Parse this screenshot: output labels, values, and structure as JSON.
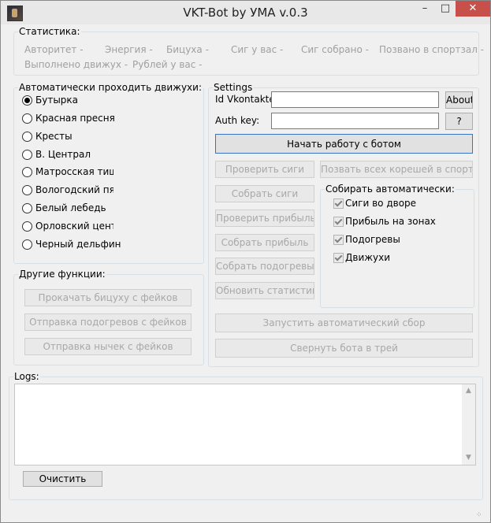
{
  "window": {
    "title": "VKT-Bot by УМА v.0.3",
    "min_glyph": "–",
    "max_glyph": "□",
    "close_glyph": "✕"
  },
  "stats": {
    "legend": "Статистика:",
    "row1": [
      "Авторитет -",
      "Энергия -",
      "Бицуха -",
      "Сиг у вас -",
      "Сиг собрано  -",
      "Позвано в спортзал -"
    ],
    "row2": [
      "Выполнено движух -",
      "Рублей у вас -"
    ]
  },
  "auto": {
    "legend": "Автоматически проходить движухи:",
    "options": [
      "Бутырка",
      "Красная пресня",
      "Кресты",
      "В. Централ",
      "Матросская тишина",
      "Вологодский пятак",
      "Белый лебедь",
      "Орловский централ",
      "Черный дельфин"
    ],
    "selected": "Бутырка"
  },
  "other": {
    "legend": "Другие функции:",
    "buttons": [
      "Прокачать бицуху с фейков",
      "Отправка подогревов с фейков",
      "Отправка нычек с фейков"
    ]
  },
  "settings": {
    "legend": "Settings",
    "id_label": "Id Vkontakte:",
    "id_value": "",
    "auth_label": "Auth key:",
    "auth_value": "",
    "about_label": "About",
    "help_label": "?",
    "start_label": "Начать работу с ботом",
    "left_buttons": [
      "Проверить сиги",
      "Собрать сиги",
      "Проверить прибыль",
      "Собрать прибыль",
      "Собрать подогревы",
      "Обновить статистику"
    ],
    "invite_label": "Позвать всех корешей в спортзал",
    "collect": {
      "legend": "Собирать автоматически:",
      "items": [
        "Сиги во дворе",
        "Прибыль на зонах",
        "Подогревы",
        "Движухи"
      ]
    },
    "run_label": "Запустить автоматический сбор",
    "tray_label": "Свернуть бота в трей"
  },
  "logs": {
    "legend": "Logs:",
    "text": "",
    "clear_label": "Очистить",
    "up_glyph": "▲",
    "down_glyph": "▼",
    "grip_glyph": "⁘"
  }
}
